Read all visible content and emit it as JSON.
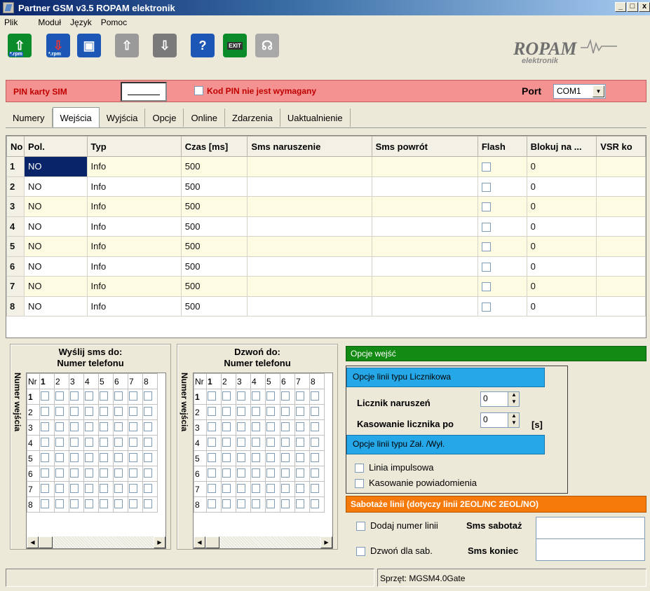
{
  "window": {
    "title": "Partner GSM v3.5 ROPAM elektronik"
  },
  "menu": [
    "Plik",
    "Moduł",
    "Język",
    "Pomoc"
  ],
  "toolbar": {
    "rpm_label": "*.rpm",
    "exit_label": "EXIT",
    "help_label": "?"
  },
  "logo": {
    "brand": "ROPAM",
    "sub": "elektronik"
  },
  "pin": {
    "label": "PIN karty SIM",
    "checkbox_label": "Kod PIN nie jest wymagany",
    "port_label": "Port",
    "port_value": "COM1"
  },
  "tabs": [
    "Numery",
    "Wejścia",
    "Wyjścia",
    "Opcje",
    "Online",
    "Zdarzenia",
    "Uaktualnienie"
  ],
  "active_tab": "Wejścia",
  "grid": {
    "columns": [
      "No",
      "Pol.",
      "Typ",
      "Czas [ms]",
      "Sms naruszenie",
      "Sms powrót",
      "Flash",
      "Blokuj na ...",
      "VSR ko"
    ],
    "rows": [
      {
        "no": "1",
        "pol": "NO",
        "typ": "Info",
        "czas": "500",
        "sms_nar": "",
        "sms_pow": "",
        "flash": false,
        "blokuj": "0",
        "vsr": ""
      },
      {
        "no": "2",
        "pol": "NO",
        "typ": "Info",
        "czas": "500",
        "sms_nar": "",
        "sms_pow": "",
        "flash": false,
        "blokuj": "0",
        "vsr": ""
      },
      {
        "no": "3",
        "pol": "NO",
        "typ": "Info",
        "czas": "500",
        "sms_nar": "",
        "sms_pow": "",
        "flash": false,
        "blokuj": "0",
        "vsr": ""
      },
      {
        "no": "4",
        "pol": "NO",
        "typ": "Info",
        "czas": "500",
        "sms_nar": "",
        "sms_pow": "",
        "flash": false,
        "blokuj": "0",
        "vsr": ""
      },
      {
        "no": "5",
        "pol": "NO",
        "typ": "Info",
        "czas": "500",
        "sms_nar": "",
        "sms_pow": "",
        "flash": false,
        "blokuj": "0",
        "vsr": ""
      },
      {
        "no": "6",
        "pol": "NO",
        "typ": "Info",
        "czas": "500",
        "sms_nar": "",
        "sms_pow": "",
        "flash": false,
        "blokuj": "0",
        "vsr": ""
      },
      {
        "no": "7",
        "pol": "NO",
        "typ": "Info",
        "czas": "500",
        "sms_nar": "",
        "sms_pow": "",
        "flash": false,
        "blokuj": "0",
        "vsr": ""
      },
      {
        "no": "8",
        "pol": "NO",
        "typ": "Info",
        "czas": "500",
        "sms_nar": "",
        "sms_pow": "",
        "flash": false,
        "blokuj": "0",
        "vsr": ""
      }
    ]
  },
  "sms_matrix": {
    "title1": "Wyślij sms do:",
    "title2": "Numer telefonu",
    "side": "Numer wejścia",
    "nr": "Nr",
    "cols": [
      "1",
      "2",
      "3",
      "4",
      "5",
      "6",
      "7",
      "8"
    ],
    "rows": [
      "1",
      "2",
      "3",
      "4",
      "5",
      "6",
      "7",
      "8"
    ]
  },
  "call_matrix": {
    "title1": "Dzwoń do:",
    "title2": "Numer telefonu",
    "side": "Numer wejścia",
    "nr": "Nr",
    "cols": [
      "1",
      "2",
      "3",
      "4",
      "5",
      "6",
      "7",
      "8"
    ],
    "rows": [
      "1",
      "2",
      "3",
      "4",
      "5",
      "6",
      "7",
      "8"
    ]
  },
  "options": {
    "header": "Opcje wejść",
    "counter_header": "Opcje linii typu Licznikowa",
    "counter_label": "Licznik naruszeń",
    "counter_value": "0",
    "reset_label": "Kasowanie licznika po",
    "reset_value": "0",
    "reset_unit": "[s]",
    "onoff_header": "Opcje linii typu Zał. /Wył.",
    "impulse_label": "Linia impulsowa",
    "clear_notify_label": "Kasowanie powiadomienia",
    "sabotage_header": "Sabotaże linii (dotyczy linii 2EOL/NC 2EOL/NO)",
    "add_line_label": "Dodaj numer linii",
    "sms_sabotage_label": "Sms sabotaż",
    "call_sab_label": "Dzwoń dla sab.",
    "sms_end_label": "Sms koniec"
  },
  "status": {
    "left": "",
    "right": "Sprzęt: MGSM4.0Gate"
  },
  "colors": {
    "pin_bar": "#f49191",
    "green_header": "#138a13",
    "blue_header": "#26a8e8",
    "orange_header": "#f57a0a",
    "row_highlight": "#fdfbe1"
  }
}
